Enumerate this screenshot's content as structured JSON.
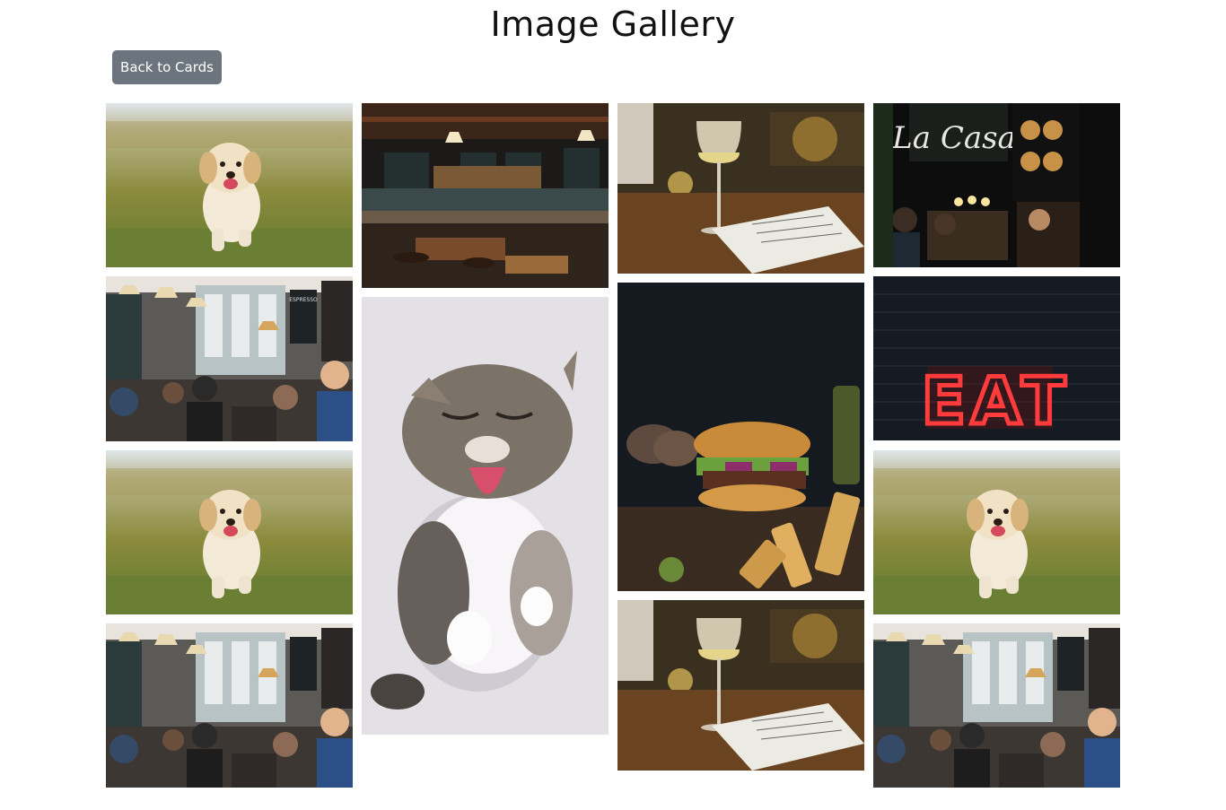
{
  "page": {
    "title": "Image Gallery",
    "back_button_label": "Back to Cards"
  },
  "gallery": {
    "columns": [
      {
        "tiles": [
          "puppy-photo",
          "cafe-interior-photo",
          "puppy-photo",
          "cafe-interior-photo"
        ]
      },
      {
        "tiles": [
          "bar-counter-photo",
          "kitten-photo"
        ]
      },
      {
        "tiles": [
          "wine-glass-menu-photo",
          "burger-fries-photo",
          "wine-glass-menu-photo"
        ]
      },
      {
        "tiles": [
          "la-casa-storefront-photo",
          "eat-neon-sign-photo",
          "puppy-photo",
          "cafe-interior-photo"
        ]
      }
    ],
    "sign_texts": {
      "la_casa": "La Casa",
      "eat": "EAT",
      "espresso": "ESPRESSO"
    }
  }
}
